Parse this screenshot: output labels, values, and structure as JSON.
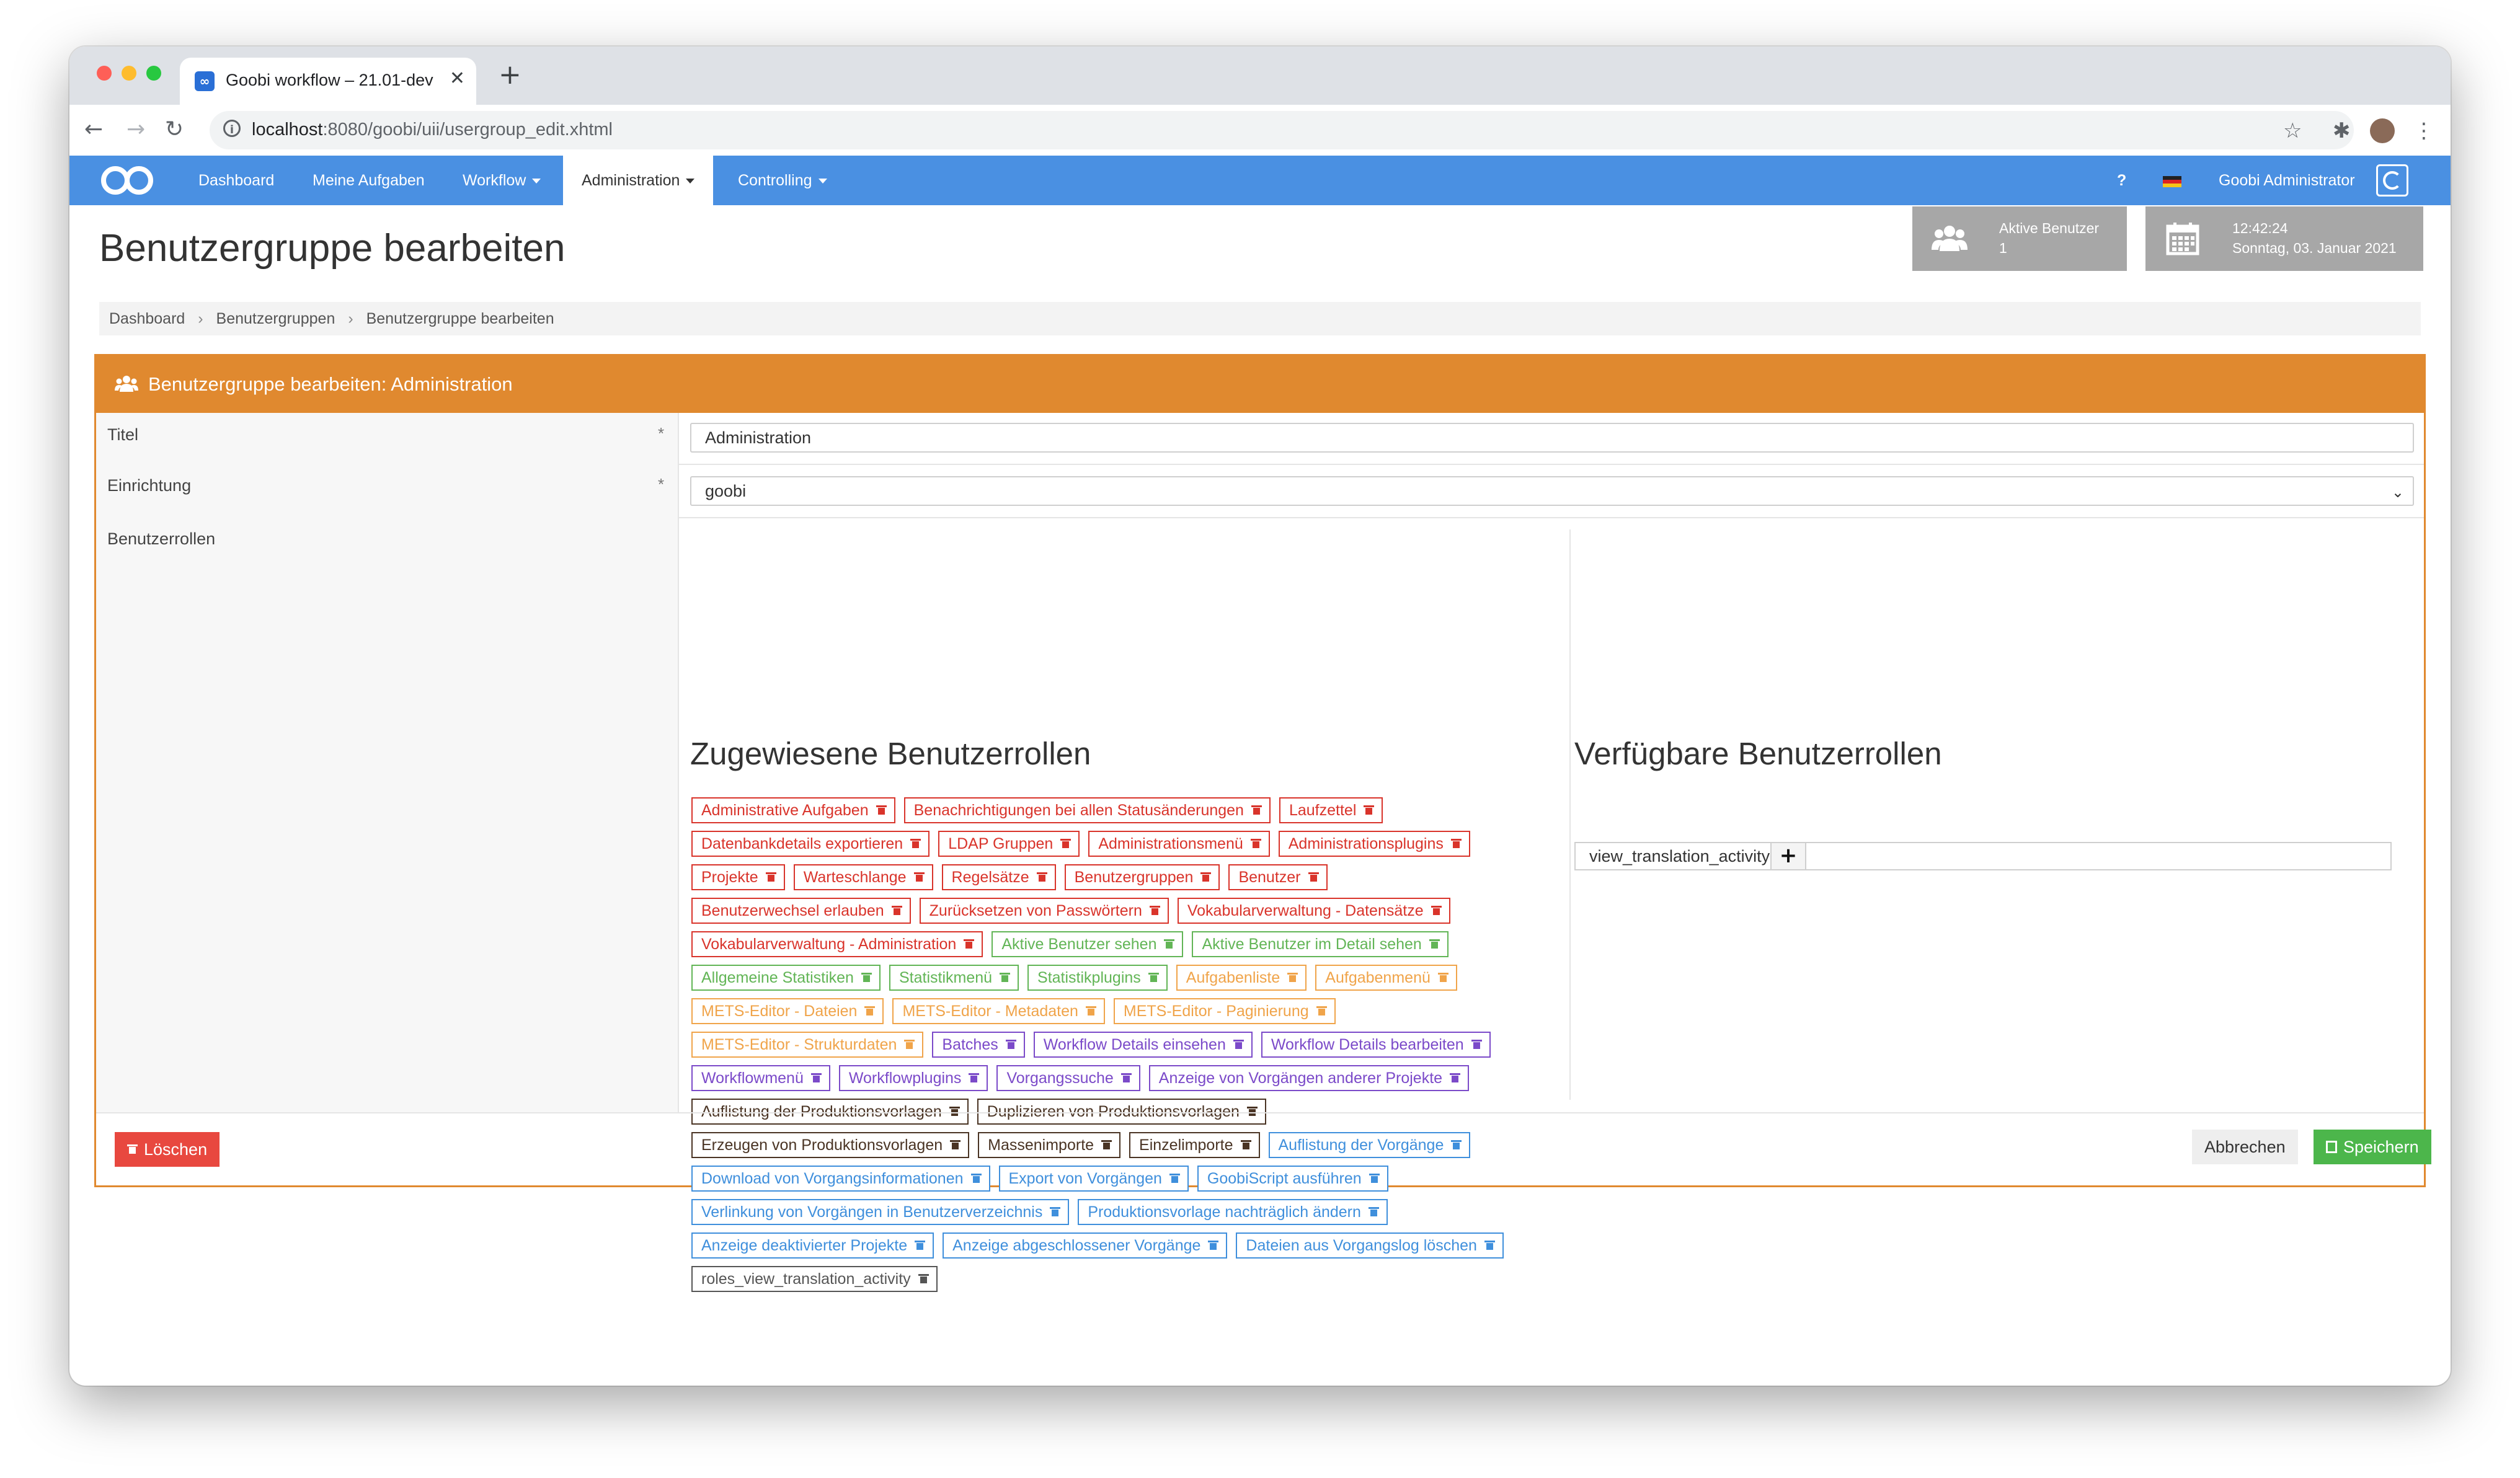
{
  "browser": {
    "tab_title": "Goobi workflow – 21.01-dev",
    "tab_close": "✕",
    "new_tab": "+",
    "url_host": "localhost",
    "url_rest": ":8080/goobi/uii/usergroup_edit.xhtml"
  },
  "nav": {
    "items": [
      {
        "label": "Dashboard",
        "dropdown": false,
        "active": false
      },
      {
        "label": "Meine Aufgaben",
        "dropdown": false,
        "active": false
      },
      {
        "label": "Workflow",
        "dropdown": true,
        "active": false
      },
      {
        "label": "Administration",
        "dropdown": true,
        "active": true
      },
      {
        "label": "Controlling",
        "dropdown": true,
        "active": false
      }
    ],
    "help": "?",
    "user": "Goobi Administrator",
    "color": "#4a90e2"
  },
  "page": {
    "title": "Benutzergruppe bearbeiten",
    "active_users_label": "Aktive Benutzer",
    "active_users_count": "1",
    "time": "12:42:24",
    "date": "Sonntag, 03. Januar 2021"
  },
  "breadcrumb": [
    "Dashboard",
    "Benutzergruppen",
    "Benutzergruppe bearbeiten"
  ],
  "box": {
    "title": "Benutzergruppe bearbeiten: Administration",
    "accent": "#e0892f"
  },
  "form": {
    "title_label": "Titel",
    "title_value": "Administration",
    "institution_label": "Einrichtung",
    "institution_value": "goobi",
    "roles_label": "Benutzerrollen",
    "required_mark": "*"
  },
  "assigned": {
    "heading": "Zugewiesene Benutzerrollen",
    "rows": [
      [
        {
          "t": "Administrative Aufgaben",
          "c": "red"
        },
        {
          "t": "Benachrichtigungen bei allen Statusänderungen",
          "c": "red"
        },
        {
          "t": "Laufzettel",
          "c": "red"
        }
      ],
      [
        {
          "t": "Datenbankdetails exportieren",
          "c": "red"
        },
        {
          "t": "LDAP Gruppen",
          "c": "red"
        },
        {
          "t": "Administrationsmenü",
          "c": "red"
        },
        {
          "t": "Administrationsplugins",
          "c": "red"
        }
      ],
      [
        {
          "t": "Projekte",
          "c": "red"
        },
        {
          "t": "Warteschlange",
          "c": "red"
        },
        {
          "t": "Regelsätze",
          "c": "red"
        },
        {
          "t": "Benutzergruppen",
          "c": "red"
        },
        {
          "t": "Benutzer",
          "c": "red"
        }
      ],
      [
        {
          "t": "Benutzerwechsel erlauben",
          "c": "red"
        },
        {
          "t": "Zurücksetzen von Passwörtern",
          "c": "red"
        },
        {
          "t": "Vokabularverwaltung - Datensätze",
          "c": "red"
        }
      ],
      [
        {
          "t": "Vokabularverwaltung - Administration",
          "c": "red"
        },
        {
          "t": "Aktive Benutzer sehen",
          "c": "green"
        },
        {
          "t": "Aktive Benutzer im Detail sehen",
          "c": "green"
        }
      ],
      [
        {
          "t": "Allgemeine Statistiken",
          "c": "green"
        },
        {
          "t": "Statistikmenü",
          "c": "green"
        },
        {
          "t": "Statistikplugins",
          "c": "green"
        },
        {
          "t": "Aufgabenliste",
          "c": "orange"
        },
        {
          "t": "Aufgabenmenü",
          "c": "orange"
        }
      ],
      [
        {
          "t": "METS-Editor - Dateien",
          "c": "orange"
        },
        {
          "t": "METS-Editor - Metadaten",
          "c": "orange"
        },
        {
          "t": "METS-Editor - Paginierung",
          "c": "orange"
        }
      ],
      [
        {
          "t": "METS-Editor - Strukturdaten",
          "c": "orange"
        },
        {
          "t": "Batches",
          "c": "purple"
        },
        {
          "t": "Workflow Details einsehen",
          "c": "purple"
        },
        {
          "t": "Workflow Details bearbeiten",
          "c": "purple"
        }
      ],
      [
        {
          "t": "Workflowmenü",
          "c": "purple"
        },
        {
          "t": "Workflowplugins",
          "c": "purple"
        },
        {
          "t": "Vorgangssuche",
          "c": "purple"
        },
        {
          "t": "Anzeige von Vorgängen anderer Projekte",
          "c": "purple"
        }
      ],
      [
        {
          "t": "Auflistung der Produktionsvorlagen",
          "c": "brown"
        },
        {
          "t": "Duplizieren von Produktionsvorlagen",
          "c": "brown"
        }
      ],
      [
        {
          "t": "Erzeugen von Produktionsvorlagen",
          "c": "brown"
        },
        {
          "t": "Massenimporte",
          "c": "brown"
        },
        {
          "t": "Einzelimporte",
          "c": "brown"
        },
        {
          "t": "Auflistung der Vorgänge",
          "c": "blue"
        }
      ],
      [
        {
          "t": "Download von Vorgangsinformationen",
          "c": "blue"
        },
        {
          "t": "Export von Vorgängen",
          "c": "blue"
        },
        {
          "t": "GoobiScript ausführen",
          "c": "blue"
        }
      ],
      [
        {
          "t": "Verlinkung von Vorgängen in Benutzerverzeichnis",
          "c": "blue"
        },
        {
          "t": "Produktionsvorlage nachträglich ändern",
          "c": "blue"
        }
      ],
      [
        {
          "t": "Anzeige deaktivierter Projekte",
          "c": "blue"
        },
        {
          "t": "Anzeige abgeschlossener Vorgänge",
          "c": "blue"
        },
        {
          "t": "Dateien aus Vorgangslog löschen",
          "c": "blue"
        }
      ],
      [
        {
          "t": "roles_view_translation_activity",
          "c": "gray"
        }
      ]
    ]
  },
  "available": {
    "heading": "Verfügbare Benutzerrollen",
    "input_value": "view_translation_activity",
    "add_label": "+"
  },
  "buttons": {
    "delete": "Löschen",
    "cancel": "Abbrechen",
    "save": "Speichern"
  },
  "tag_colors": {
    "red": "#d9342b",
    "green": "#62b556",
    "orange": "#f0a44a",
    "purple": "#7b4ac9",
    "brown": "#4a3424",
    "blue": "#3f8fdc",
    "gray": "#555555"
  }
}
